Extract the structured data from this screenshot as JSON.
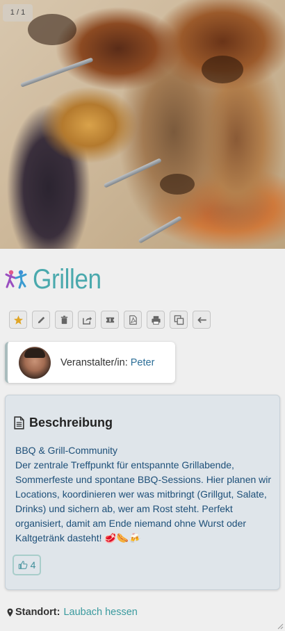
{
  "gallery": {
    "counter": "1 / 1",
    "image_subject": "grilled-skewers-photo"
  },
  "event": {
    "title": "Grillen",
    "icon": "dancing-people-icon"
  },
  "toolbar": {
    "buttons": [
      {
        "name": "favorite-button",
        "icon": "star-icon"
      },
      {
        "name": "edit-button",
        "icon": "pencil-icon"
      },
      {
        "name": "delete-button",
        "icon": "trash-icon"
      },
      {
        "name": "share-button",
        "icon": "share-icon"
      },
      {
        "name": "ticket-button",
        "icon": "ticket-icon"
      },
      {
        "name": "pdf-button",
        "icon": "pdf-icon"
      },
      {
        "name": "print-button",
        "icon": "print-icon"
      },
      {
        "name": "copy-button",
        "icon": "copy-icon"
      },
      {
        "name": "back-button",
        "icon": "arrow-left-icon"
      }
    ]
  },
  "organizer": {
    "label": "Veranstalter/in:",
    "name": "Peter"
  },
  "description": {
    "heading": "Beschreibung",
    "line1": "BBQ & Grill-Community",
    "body": "Der zentrale Treffpunkt für entspannte Grillabende, Sommerfeste und spontane BBQ-Sessions. Hier planen wir Locations, koordinieren wer was mitbringt (Grillgut, Salate, Drinks) und sichern ab, wer am Rost steht. Perfekt organisiert, damit am Ende niemand ohne Wurst oder Kaltgetränk dasteht! 🥩🌭🍻",
    "likes": "4"
  },
  "location": {
    "label": "Standort:",
    "value": "Laubach hessen"
  },
  "colors": {
    "accent": "#4aa9ad",
    "link": "#2d6f98",
    "panel": "#dfe5ea",
    "star": "#e0a526"
  }
}
